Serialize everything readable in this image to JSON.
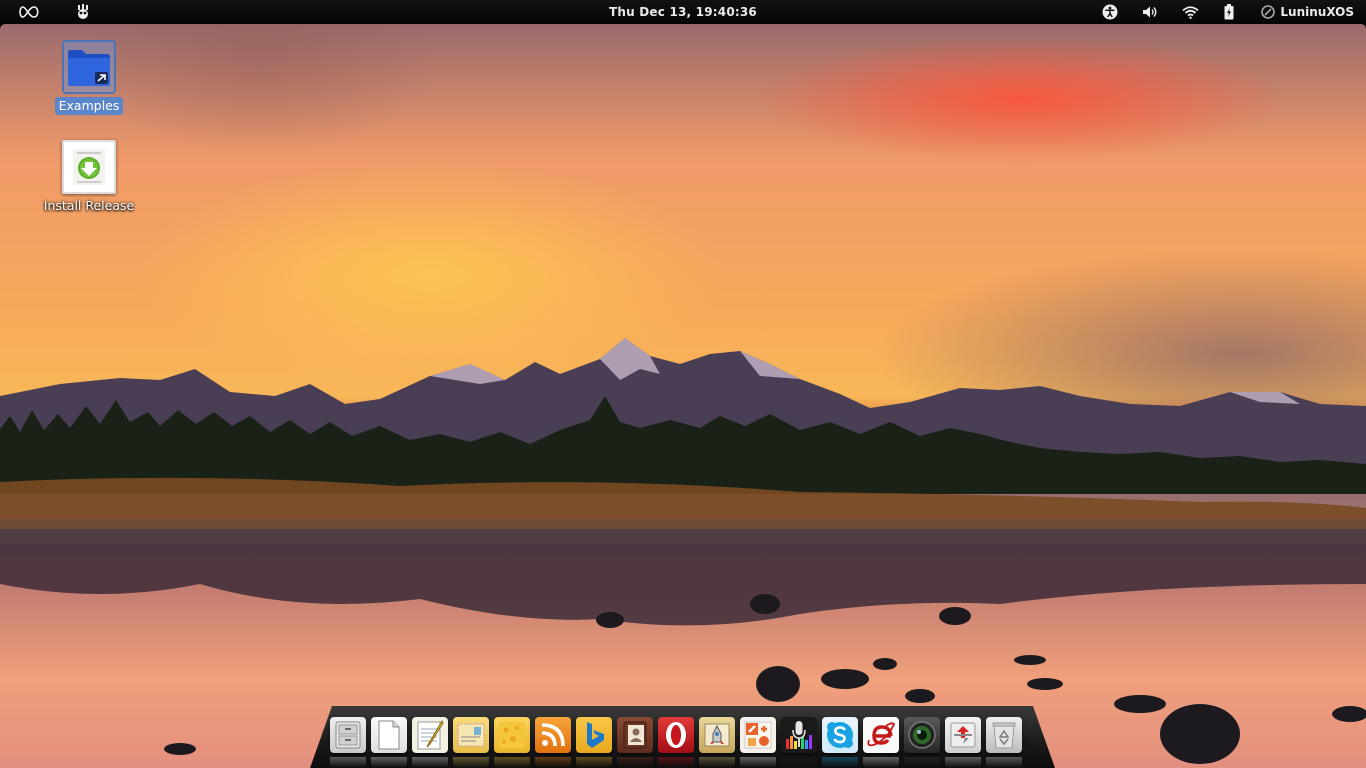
{
  "top_panel": {
    "clock": "Thu Dec 13, 19:40:36",
    "user": "LuninuXOS",
    "indicators": [
      "accessibility-icon",
      "volume-icon",
      "wifi-icon",
      "battery-icon"
    ]
  },
  "desktop": {
    "icons": [
      {
        "label": "Examples",
        "icon": "folder-link-icon"
      },
      {
        "label": "Install Release",
        "icon": "installer-icon"
      }
    ]
  },
  "dock": {
    "apps": [
      {
        "name": "file-manager",
        "color": "#d9d9d9"
      },
      {
        "name": "text-document",
        "color": "#f2f2f2"
      },
      {
        "name": "text-editor",
        "color": "#f1f1e6"
      },
      {
        "name": "mail",
        "color": "#f3d46a"
      },
      {
        "name": "notes",
        "color": "#f2c33c"
      },
      {
        "name": "rss-reader",
        "color": "#f08a1c"
      },
      {
        "name": "bing",
        "color": "#f4b72e"
      },
      {
        "name": "contacts",
        "color": "#7a3b2a"
      },
      {
        "name": "opera-browser",
        "color": "#c8161d"
      },
      {
        "name": "image-viewer",
        "color": "#d8c07a"
      },
      {
        "name": "system-tools",
        "color": "#f5f1ea"
      },
      {
        "name": "audio-recorder",
        "color": "#222222"
      },
      {
        "name": "skype",
        "color": "#1aa3e2"
      },
      {
        "name": "internet-explorer",
        "color": "#fafafa"
      },
      {
        "name": "webcam",
        "color": "#3c3c3c"
      },
      {
        "name": "update-manager",
        "color": "#e9e9e9"
      },
      {
        "name": "trash",
        "color": "#d6d6d6"
      }
    ]
  }
}
